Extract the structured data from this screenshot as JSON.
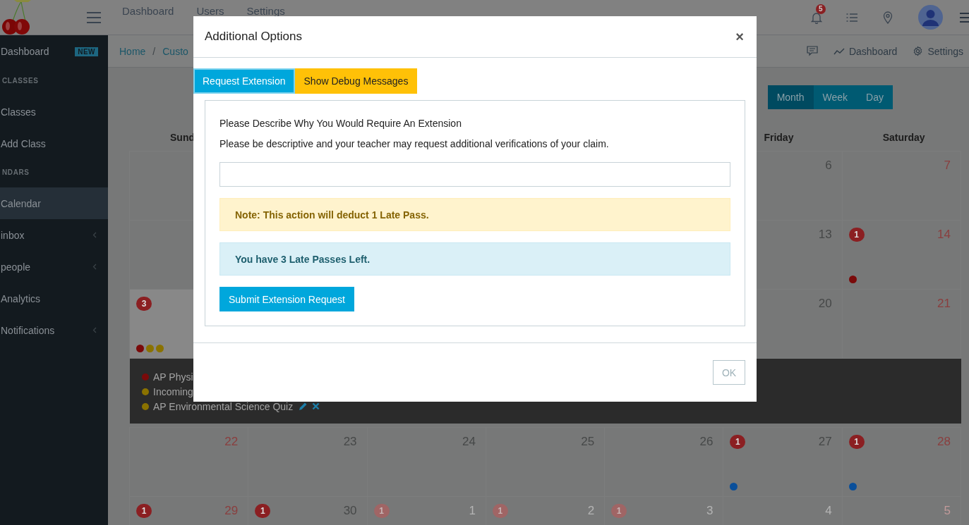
{
  "header": {
    "nav": [
      "Dashboard",
      "Users",
      "Settings"
    ],
    "notification_badge": "5"
  },
  "sidebar": {
    "items": [
      {
        "kind": "link",
        "label": "Dashboard",
        "badge": "NEW",
        "selected": false,
        "expandable": false
      },
      {
        "kind": "heading",
        "label": "CLASSES"
      },
      {
        "kind": "link",
        "label": "Classes",
        "selected": false,
        "expandable": false
      },
      {
        "kind": "link",
        "label": "Add Class",
        "selected": false,
        "expandable": false
      },
      {
        "kind": "heading",
        "label": "NDARS"
      },
      {
        "kind": "link",
        "label": "Calendar",
        "selected": true,
        "expandable": false
      },
      {
        "kind": "link",
        "label": "inbox",
        "selected": false,
        "expandable": true
      },
      {
        "kind": "link",
        "label": "people",
        "selected": false,
        "expandable": true
      },
      {
        "kind": "link",
        "label": "Analytics",
        "selected": false,
        "expandable": false
      },
      {
        "kind": "link",
        "label": "Notifications",
        "selected": false,
        "expandable": true
      }
    ]
  },
  "breadcrumb": {
    "items": [
      "Home",
      "Custo"
    ],
    "separator": "/"
  },
  "toolbar": {
    "links": [
      {
        "kind": "dashboard",
        "label": "Dashboard"
      },
      {
        "kind": "settings",
        "label": "Settings"
      }
    ]
  },
  "view_switch": [
    {
      "label": "Month",
      "selected": true
    },
    {
      "label": "Week",
      "selected": false
    },
    {
      "label": "Day",
      "selected": false
    }
  ],
  "calendar": {
    "weekdays": {
      "sunday": "Sund",
      "friday": "Friday",
      "saturday": "Saturday"
    },
    "weeks": [
      {
        "sunday": {
          "selected": false
        },
        "friday": {
          "day": "6",
          "selected": false
        },
        "saturday": {
          "day": "7",
          "selected": false
        }
      },
      {
        "sunday": {
          "selected": false
        },
        "friday": {
          "day": "13",
          "selected": false
        },
        "saturday": {
          "day": "14",
          "badge": "1",
          "dots": [
            {
              "color": "#7a0a0a"
            }
          ],
          "selected": false
        }
      },
      {
        "sunday": {
          "badge": "3",
          "dots": [
            {
              "color": "#7a0a0a"
            },
            {
              "color": "#8a7200"
            },
            {
              "color": "#8a7200"
            }
          ],
          "selected": true
        },
        "friday": {
          "day": "20",
          "selected": false
        },
        "saturday": {
          "day": "21",
          "selected": false
        },
        "events": [
          {
            "title": "AP Physi",
            "color": "#7a0a0a"
          },
          {
            "title": "Incoming",
            "color": "#8a7200"
          },
          {
            "title": "AP Environmental Science Quiz",
            "color": "#8a7200",
            "editable": true
          }
        ]
      },
      {
        "sunday": {
          "day": "22",
          "selected": false
        },
        "monday": {
          "day": "23",
          "selected": false
        },
        "tuesday": {
          "day": "24",
          "selected": false
        },
        "wednesday": {
          "day": "25",
          "selected": false
        },
        "thursday": {
          "day": "26",
          "selected": false
        },
        "friday": {
          "day": "27",
          "badge": "1",
          "dots": [
            {
              "color": "#0a4f9a"
            }
          ],
          "selected": false
        },
        "saturday": {
          "day": "28",
          "badge": "1",
          "dots": [
            {
              "color": "#0a4f9a"
            }
          ],
          "selected": false
        }
      },
      {
        "sunday": {
          "day": "29",
          "badge": "1",
          "other_month": false,
          "selected": false
        },
        "monday": {
          "day": "30",
          "badge": "1",
          "other_month": false,
          "selected": false
        },
        "tuesday": {
          "day": "1",
          "badge": "1",
          "other_month": true,
          "selected": false
        },
        "wednesday": {
          "day": "2",
          "badge": "1",
          "other_month": true,
          "selected": false
        },
        "thursday": {
          "day": "3",
          "badge": "1",
          "other_month": true,
          "selected": false
        },
        "friday": {
          "day": "4",
          "other_month": true,
          "selected": false
        },
        "saturday": {
          "day": "5",
          "other_month": true,
          "selected": false
        }
      }
    ]
  },
  "modal": {
    "title": "Additional Options",
    "close": "×",
    "tabs": [
      {
        "label": "Request Extension",
        "selected": true
      },
      {
        "label": "Show Debug Messages",
        "selected": false
      }
    ],
    "prompt": "Please Describe Why You Would Require An Extension",
    "hint": "Please be descriptive and your teacher may request additional verifications of your claim.",
    "alerts": [
      {
        "kind": "warning",
        "text": "Note: This action will deduct 1 Late Pass."
      },
      {
        "kind": "info",
        "text": "You have 3 Late Passes Left."
      }
    ],
    "submit_button": "Submit Extension Request",
    "ok_button": "OK"
  }
}
